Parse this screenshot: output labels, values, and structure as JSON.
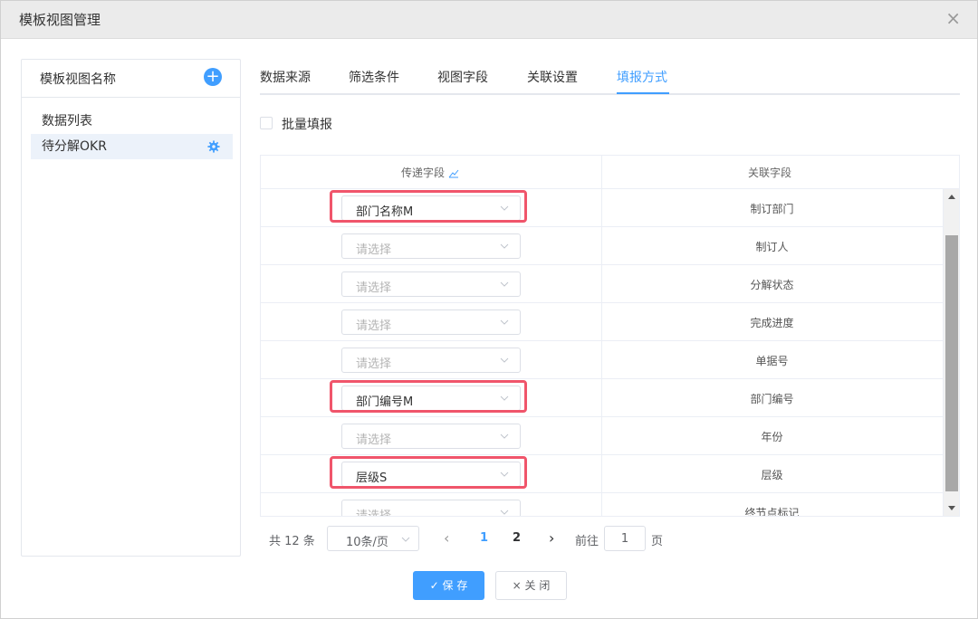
{
  "dialog": {
    "title": "模板视图管理",
    "close_glyph": "×"
  },
  "left_panel": {
    "title": "模板视图名称",
    "add_glyph": "+",
    "items": [
      {
        "label": "数据列表"
      },
      {
        "label": "待分解OKR"
      }
    ]
  },
  "tabs": [
    {
      "label": "数据来源"
    },
    {
      "label": "筛选条件"
    },
    {
      "label": "视图字段"
    },
    {
      "label": "关联设置"
    },
    {
      "label": "填报方式"
    }
  ],
  "active_tab": "填报方式",
  "batch_fill": {
    "label": "批量填报",
    "checked": false
  },
  "table": {
    "headers": {
      "pass": "传递字段",
      "related": "关联字段"
    },
    "placeholder": "请选择",
    "rows": [
      {
        "value": "部门名称M",
        "related": "制订部门",
        "highlighted": true
      },
      {
        "value": "",
        "related": "制订人",
        "highlighted": false
      },
      {
        "value": "",
        "related": "分解状态",
        "highlighted": false
      },
      {
        "value": "",
        "related": "完成进度",
        "highlighted": false
      },
      {
        "value": "",
        "related": "单据号",
        "highlighted": false
      },
      {
        "value": "部门编号M",
        "related": "部门编号",
        "highlighted": true
      },
      {
        "value": "",
        "related": "年份",
        "highlighted": false
      },
      {
        "value": "层级S",
        "related": "层级",
        "highlighted": true
      },
      {
        "value": "",
        "related": "终节点标记",
        "highlighted": false
      }
    ]
  },
  "pagination": {
    "total_text": "共 12 条",
    "page_size": "10条/页",
    "pages": [
      "1",
      "2"
    ],
    "current_page": "1",
    "goto_label": "前往",
    "goto_value": "1",
    "page_suffix": "页"
  },
  "buttons": {
    "save": "✓ 保 存",
    "close": "× 关 闭"
  },
  "colors": {
    "primary": "#409eff",
    "highlight": "#f0556b"
  }
}
